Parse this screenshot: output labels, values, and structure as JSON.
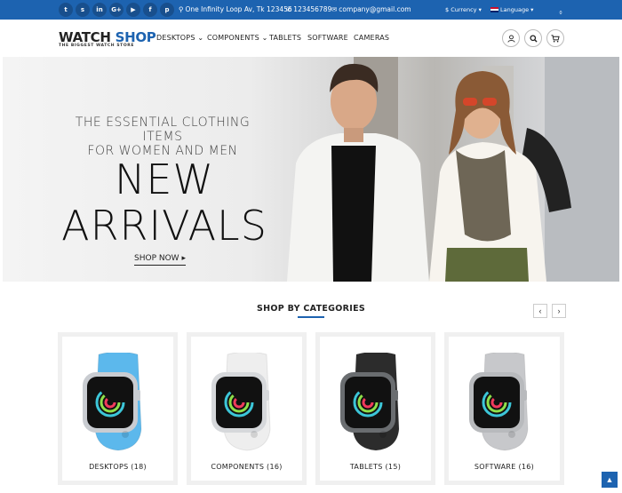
{
  "topbar": {
    "social": [
      {
        "name": "twitter-icon",
        "glyph": "t"
      },
      {
        "name": "skype-icon",
        "glyph": "s"
      },
      {
        "name": "linkedin-icon",
        "glyph": "in"
      },
      {
        "name": "google-plus-icon",
        "glyph": "G+"
      },
      {
        "name": "youtube-icon",
        "glyph": "▶"
      },
      {
        "name": "facebook-icon",
        "glyph": "f"
      },
      {
        "name": "pinterest-icon",
        "glyph": "p"
      }
    ],
    "address": "One Infinity Loop Av, Tk 123456",
    "phone": "123456789",
    "email": "company@gmail.com",
    "currency": "Currency",
    "language": "Language"
  },
  "header": {
    "logo_prefix": "WATCH",
    "logo_suffix": "SHOP",
    "tagline": "THE BIGGEST WATCH STORE",
    "nav": [
      "DESKTOPS",
      "COMPONENTS",
      "TABLETS",
      "SOFTWARE",
      "CAMERAS"
    ],
    "cart_count": "0"
  },
  "hero": {
    "subtitle_line1": "THE ESSENTIAL CLOTHING ITEMS",
    "subtitle_line2": "FOR WOMEN AND MEN",
    "title_line1": "NEW",
    "title_line2": "ARRIVALS",
    "cta": "SHOP NOW"
  },
  "categories": {
    "title": "SHOP BY CATEGORIES",
    "items": [
      {
        "label": "DESKTOPS (18)",
        "band": "#5cb8ec",
        "case": "#c9ccd1"
      },
      {
        "label": "COMPONENTS (16)",
        "band": "#eeeeee",
        "case": "#d6d8db"
      },
      {
        "label": "TABLETS (15)",
        "band": "#2c2c2c",
        "case": "#6a6d70"
      },
      {
        "label": "SOFTWARE (16)",
        "band": "#c7c8cb",
        "case": "#b8babd"
      }
    ]
  },
  "colors": {
    "brand": "#1d63b0"
  }
}
